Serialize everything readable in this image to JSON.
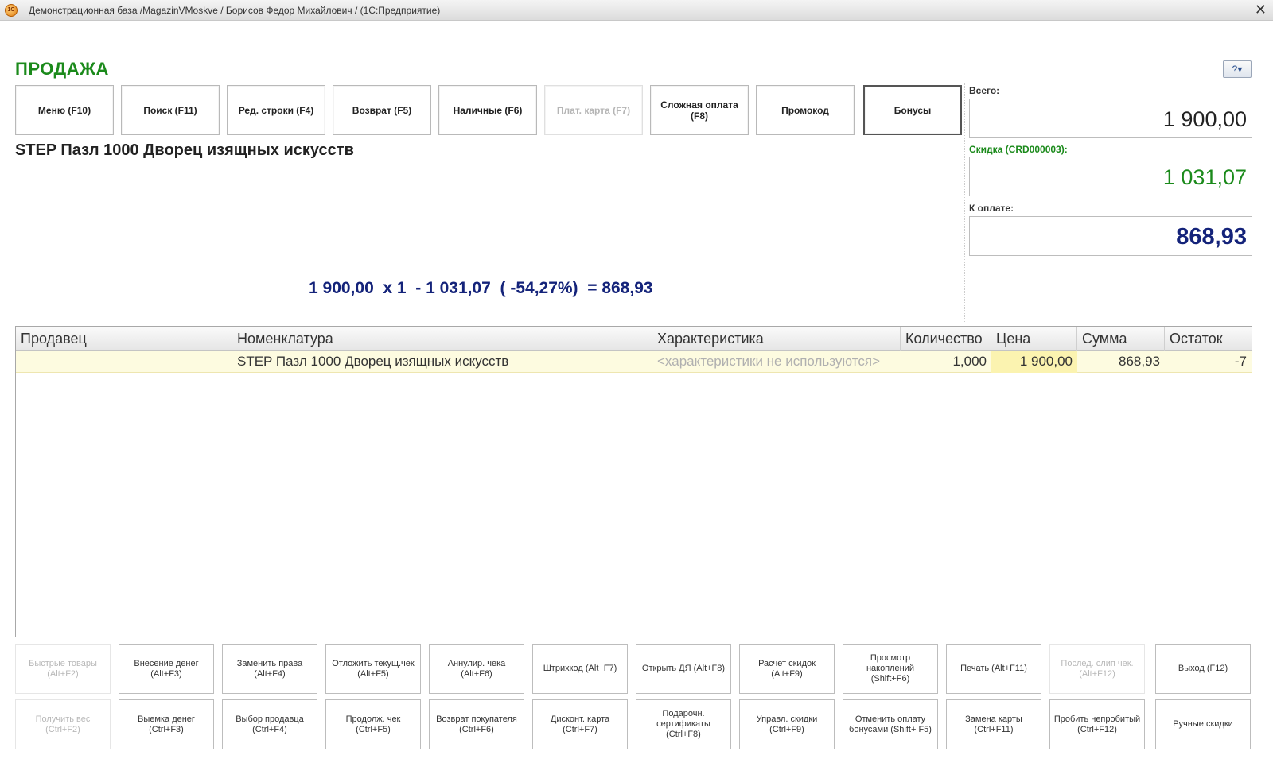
{
  "window": {
    "title": "Демонстрационная база /MagazinVMoskve / Борисов Федор Михайлович / (1С:Предприятие)",
    "icon_text": "1С",
    "close_glyph": "✕",
    "help_label": "?▾"
  },
  "page_title": "ПРОДАЖА",
  "top_buttons": [
    {
      "label": "Меню (F10)",
      "enabled": true
    },
    {
      "label": "Поиск (F11)",
      "enabled": true
    },
    {
      "label": "Ред. строки (F4)",
      "enabled": true
    },
    {
      "label": "Возврат (F5)",
      "enabled": true
    },
    {
      "label": "Наличные (F6)",
      "enabled": true
    },
    {
      "label": "Плат. карта (F7)",
      "enabled": false
    },
    {
      "label": "Сложная оплата (F8)",
      "enabled": true
    },
    {
      "label": "Промокод",
      "enabled": true
    },
    {
      "label": "Бонусы",
      "enabled": true
    }
  ],
  "product_name": "STEP Пазл 1000 Дворец изящных искусств",
  "formula": "1 900,00  x 1  - 1 031,07  ( -54,27%)  = 868,93",
  "totals": {
    "total_label": "Всего:",
    "total_value": "1 900,00",
    "discount_label": "Скидка (CRD000003):",
    "discount_value": "1 031,07",
    "to_pay_label": "К оплате:",
    "to_pay_value": "868,93"
  },
  "table": {
    "columns": [
      "Продавец",
      "Номенклатура",
      "Характеристика",
      "Количество",
      "Цена",
      "Сумма",
      "Остаток"
    ],
    "rows": [
      [
        "",
        "STEP Пазл 1000 Дворец изящных искусств",
        "<характеристики не используются>",
        "1,000",
        "1 900,00",
        "868,93",
        "-7"
      ]
    ]
  },
  "function_buttons_row1": [
    {
      "label": "Быстрые товары\n(Alt+F2)",
      "enabled": false
    },
    {
      "label": "Внесение денег\n(Alt+F3)",
      "enabled": true
    },
    {
      "label": "Заменить права\n(Alt+F4)",
      "enabled": true
    },
    {
      "label": "Отложить текущ.чек\n(Alt+F5)",
      "enabled": true
    },
    {
      "label": "Аннулир. чека (Alt+F6)",
      "enabled": true
    },
    {
      "label": "Штрихкод (Alt+F7)",
      "enabled": true
    },
    {
      "label": "Открыть ДЯ (Alt+F8)",
      "enabled": true
    },
    {
      "label": "Расчет скидок (Alt+F9)",
      "enabled": true
    },
    {
      "label": "Просмотр накоплений\n(Shift+F6)",
      "enabled": true
    },
    {
      "label": "Печать (Alt+F11)",
      "enabled": true
    },
    {
      "label": "Послед. слип чек.\n(Alt+F12)",
      "enabled": false
    },
    {
      "label": "Выход (F12)",
      "enabled": true
    }
  ],
  "function_buttons_row2": [
    {
      "label": "Получить вес (Ctrl+F2)",
      "enabled": false
    },
    {
      "label": "Выемка денег\n(Ctrl+F3)",
      "enabled": true
    },
    {
      "label": "Выбор продавца\n(Ctrl+F4)",
      "enabled": true
    },
    {
      "label": "Продолж. чек (Ctrl+F5)",
      "enabled": true
    },
    {
      "label": "Возврат покупателя\n(Ctrl+F6)",
      "enabled": true
    },
    {
      "label": "Дисконт. карта\n(Ctrl+F7)",
      "enabled": true
    },
    {
      "label": "Подарочн.\nсертификаты (Ctrl+F8)",
      "enabled": true
    },
    {
      "label": "Управл. скидки\n(Ctrl+F9)",
      "enabled": true
    },
    {
      "label": "Отменить оплату\nбонусами (Shift+ F5)",
      "enabled": true
    },
    {
      "label": "Замена карты\n(Ctrl+F11)",
      "enabled": true
    },
    {
      "label": "Пробить непробитый\n(Ctrl+F12)",
      "enabled": true
    },
    {
      "label": "Ручные скидки",
      "enabled": true
    }
  ]
}
